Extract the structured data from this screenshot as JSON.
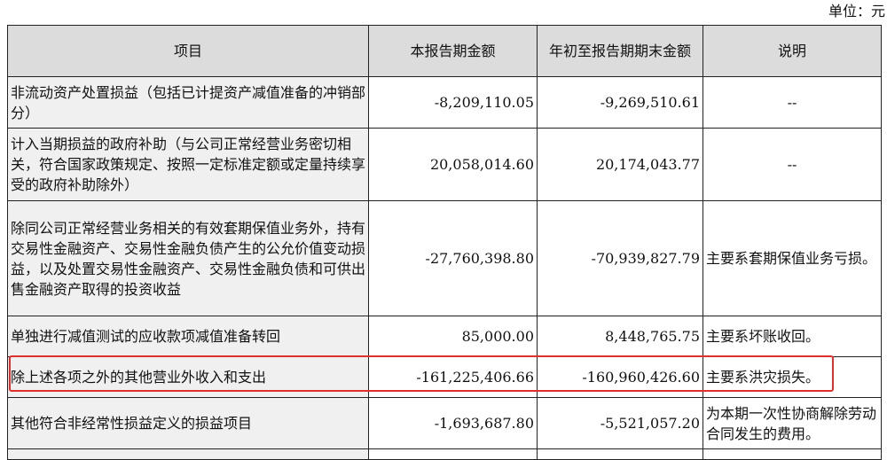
{
  "unit_label": "单位：元",
  "headers": {
    "item": "项目",
    "current_period": "本报告期金额",
    "ytd": "年初至报告期期末金额",
    "note": "说明"
  },
  "rows": [
    {
      "item": "非流动资产处置损益（包括已计提资产减值准备的冲销部分）",
      "current_period": "-8,209,110.05",
      "ytd": "-9,269,510.61",
      "note": "--"
    },
    {
      "item": "计入当期损益的政府补助（与公司正常经营业务密切相关，符合国家政策规定、按照一定标准定额或定量持续享受的政府补助除外）",
      "current_period": "20,058,014.60",
      "ytd": "20,174,043.77",
      "note": "--"
    },
    {
      "item": "除同公司正常经营业务相关的有效套期保值业务外，持有交易性金融资产、交易性金融负债产生的公允价值变动损益，以及处置交易性金融资产、交易性金融负债和可供出售金融资产取得的投资收益",
      "current_period": "-27,760,398.80",
      "ytd": "-70,939,827.79",
      "note": "主要系套期保值业务亏损。"
    },
    {
      "item": "单独进行减值测试的应收款项减值准备转回",
      "current_period": "85,000.00",
      "ytd": "8,448,765.75",
      "note": "主要系坏账收回。"
    },
    {
      "item": "除上述各项之外的其他营业外收入和支出",
      "current_period": "-161,225,406.66",
      "ytd": "-160,960,426.60",
      "note": "主要系洪灾损失。"
    },
    {
      "item": "其他符合非经常性损益定义的损益项目",
      "current_period": "-1,693,687.80",
      "ytd": "-5,521,057.20",
      "note": "为本期一次性协商解除劳动合同发生的费用。"
    }
  ],
  "highlight_color": "#e0302d"
}
